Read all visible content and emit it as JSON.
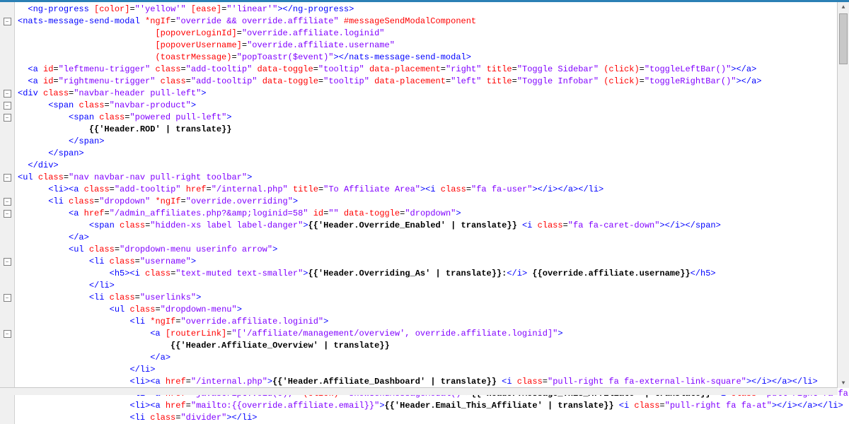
{
  "gutter": [
    "",
    "-",
    "",
    "",
    "",
    "",
    "",
    "-",
    "-",
    "-",
    "",
    "",
    "",
    "",
    "-",
    "",
    "-",
    "-",
    "",
    "",
    "",
    "-",
    "",
    "",
    "-",
    "",
    "",
    "-",
    "",
    "",
    "",
    "",
    ""
  ],
  "tokens": [
    [
      [
        2,
        "t-tag",
        "<ng-progress"
      ],
      [
        " "
      ],
      [
        "t-attr",
        "[color]"
      ],
      [
        "t-eq",
        "="
      ],
      [
        "t-val",
        "\"'yellow'\""
      ],
      [
        " "
      ],
      [
        "t-attr",
        "[ease]"
      ],
      [
        "t-eq",
        "="
      ],
      [
        "t-val",
        "\"'linear'\""
      ],
      [
        "t-tag",
        "></ng-progress>"
      ]
    ],
    [
      [
        0,
        "t-tag",
        "<nats-message-send-modal"
      ],
      [
        " "
      ],
      [
        "t-attr",
        "*ngIf"
      ],
      [
        "t-eq",
        "="
      ],
      [
        "t-val",
        "\"override && override.affiliate\""
      ],
      [
        " "
      ],
      [
        "t-attr",
        "#messageSendModalComponent"
      ]
    ],
    [
      [
        27,
        "t-attr",
        "[popoverLoginId]"
      ],
      [
        "t-eq",
        "="
      ],
      [
        "t-val",
        "\"override.affiliate.loginid\""
      ]
    ],
    [
      [
        27,
        "t-attr",
        "[popoverUsername]"
      ],
      [
        "t-eq",
        "="
      ],
      [
        "t-val",
        "\"override.affiliate.username\""
      ]
    ],
    [
      [
        27,
        "t-attr",
        "(toastrMessage)"
      ],
      [
        "t-eq",
        "="
      ],
      [
        "t-val",
        "\"popToastr($event)\""
      ],
      [
        "t-tag",
        "></nats-message-send-modal>"
      ]
    ],
    [
      [
        2,
        "t-tag",
        "<a"
      ],
      [
        " "
      ],
      [
        "t-attr",
        "id"
      ],
      [
        "t-eq",
        "="
      ],
      [
        "t-val",
        "\"leftmenu-trigger\""
      ],
      [
        " "
      ],
      [
        "t-attr",
        "class"
      ],
      [
        "t-eq",
        "="
      ],
      [
        "t-val",
        "\"add-tooltip\""
      ],
      [
        " "
      ],
      [
        "t-attr",
        "data-toggle"
      ],
      [
        "t-eq",
        "="
      ],
      [
        "t-val",
        "\"tooltip\""
      ],
      [
        " "
      ],
      [
        "t-attr",
        "data-placement"
      ],
      [
        "t-eq",
        "="
      ],
      [
        "t-val",
        "\"right\""
      ],
      [
        " "
      ],
      [
        "t-attr",
        "title"
      ],
      [
        "t-eq",
        "="
      ],
      [
        "t-val",
        "\"Toggle Sidebar\""
      ],
      [
        " "
      ],
      [
        "t-attr",
        "(click)"
      ],
      [
        "t-eq",
        "="
      ],
      [
        "t-val",
        "\"toggleLeftBar()\""
      ],
      [
        "t-tag",
        "></a>"
      ]
    ],
    [
      [
        2,
        "t-tag",
        "<a"
      ],
      [
        " "
      ],
      [
        "t-attr",
        "id"
      ],
      [
        "t-eq",
        "="
      ],
      [
        "t-val",
        "\"rightmenu-trigger\""
      ],
      [
        " "
      ],
      [
        "t-attr",
        "class"
      ],
      [
        "t-eq",
        "="
      ],
      [
        "t-val",
        "\"add-tooltip\""
      ],
      [
        " "
      ],
      [
        "t-attr",
        "data-toggle"
      ],
      [
        "t-eq",
        "="
      ],
      [
        "t-val",
        "\"tooltip\""
      ],
      [
        " "
      ],
      [
        "t-attr",
        "data-placement"
      ],
      [
        "t-eq",
        "="
      ],
      [
        "t-val",
        "\"left\""
      ],
      [
        " "
      ],
      [
        "t-attr",
        "title"
      ],
      [
        "t-eq",
        "="
      ],
      [
        "t-val",
        "\"Toggle Infobar\""
      ],
      [
        " "
      ],
      [
        "t-attr",
        "(click)"
      ],
      [
        "t-eq",
        "="
      ],
      [
        "t-val",
        "\"toggleRightBar()\""
      ],
      [
        "t-tag",
        "></a>"
      ]
    ],
    [
      [
        0,
        "t-tag",
        "<div"
      ],
      [
        " "
      ],
      [
        "t-attr",
        "class"
      ],
      [
        "t-eq",
        "="
      ],
      [
        "t-val",
        "\"navbar-header pull-left\""
      ],
      [
        "t-tag",
        ">"
      ]
    ],
    [
      [
        6,
        "t-tag",
        "<span"
      ],
      [
        " "
      ],
      [
        "t-attr",
        "class"
      ],
      [
        "t-eq",
        "="
      ],
      [
        "t-val",
        "\"navbar-product\""
      ],
      [
        "t-tag",
        ">"
      ]
    ],
    [
      [
        10,
        "t-tag",
        "<span"
      ],
      [
        " "
      ],
      [
        "t-attr",
        "class"
      ],
      [
        "t-eq",
        "="
      ],
      [
        "t-val",
        "\"powered pull-left\""
      ],
      [
        "t-tag",
        ">"
      ]
    ],
    [
      [
        14,
        "t-text",
        "{{'Header.ROD' | translate}}"
      ]
    ],
    [
      [
        10,
        "t-tag",
        "</span>"
      ]
    ],
    [
      [
        6,
        "t-tag",
        "</span>"
      ]
    ],
    [
      [
        2,
        "t-tag",
        "</div>"
      ]
    ],
    [
      [
        0,
        "t-tag",
        "<ul"
      ],
      [
        " "
      ],
      [
        "t-attr",
        "class"
      ],
      [
        "t-eq",
        "="
      ],
      [
        "t-val",
        "\"nav navbar-nav pull-right toolbar\""
      ],
      [
        "t-tag",
        ">"
      ]
    ],
    [
      [
        6,
        "t-tag",
        "<li><a"
      ],
      [
        " "
      ],
      [
        "t-attr",
        "class"
      ],
      [
        "t-eq",
        "="
      ],
      [
        "t-val",
        "\"add-tooltip\""
      ],
      [
        " "
      ],
      [
        "t-attr",
        "href"
      ],
      [
        "t-eq",
        "="
      ],
      [
        "t-val",
        "\"/internal.php\""
      ],
      [
        " "
      ],
      [
        "t-attr",
        "title"
      ],
      [
        "t-eq",
        "="
      ],
      [
        "t-val",
        "\"To Affiliate Area\""
      ],
      [
        "t-tag",
        "><i"
      ],
      [
        " "
      ],
      [
        "t-attr",
        "class"
      ],
      [
        "t-eq",
        "="
      ],
      [
        "t-val",
        "\"fa fa-user\""
      ],
      [
        "t-tag",
        "></i></a></li>"
      ]
    ],
    [
      [
        6,
        "t-tag",
        "<li"
      ],
      [
        " "
      ],
      [
        "t-attr",
        "class"
      ],
      [
        "t-eq",
        "="
      ],
      [
        "t-val",
        "\"dropdown\""
      ],
      [
        " "
      ],
      [
        "t-attr",
        "*ngIf"
      ],
      [
        "t-eq",
        "="
      ],
      [
        "t-val",
        "\"override.overriding\""
      ],
      [
        "t-tag",
        ">"
      ]
    ],
    [
      [
        10,
        "t-tag",
        "<a"
      ],
      [
        " "
      ],
      [
        "t-attr",
        "href"
      ],
      [
        "t-eq",
        "="
      ],
      [
        "t-val",
        "\"/admin_affiliates.php?&amp;loginid=58\""
      ],
      [
        " "
      ],
      [
        "t-attr",
        "id"
      ],
      [
        "t-eq",
        "="
      ],
      [
        "t-val",
        "\"\""
      ],
      [
        " "
      ],
      [
        "t-attr",
        "data-toggle"
      ],
      [
        "t-eq",
        "="
      ],
      [
        "t-val",
        "\"dropdown\""
      ],
      [
        "t-tag",
        ">"
      ]
    ],
    [
      [
        14,
        "t-tag",
        "<span"
      ],
      [
        " "
      ],
      [
        "t-attr",
        "class"
      ],
      [
        "t-eq",
        "="
      ],
      [
        "t-val",
        "\"hidden-xs label label-danger\""
      ],
      [
        "t-tag",
        ">"
      ],
      [
        "t-text",
        "{{'Header.Override_Enabled' | translate}} "
      ],
      [
        "t-tag",
        "<i"
      ],
      [
        " "
      ],
      [
        "t-attr",
        "class"
      ],
      [
        "t-eq",
        "="
      ],
      [
        "t-val",
        "\"fa fa-caret-down\""
      ],
      [
        "t-tag",
        "></i></span>"
      ]
    ],
    [
      [
        10,
        "t-tag",
        "</a>"
      ]
    ],
    [
      [
        10,
        "t-tag",
        "<ul"
      ],
      [
        " "
      ],
      [
        "t-attr",
        "class"
      ],
      [
        "t-eq",
        "="
      ],
      [
        "t-val",
        "\"dropdown-menu userinfo arrow\""
      ],
      [
        "t-tag",
        ">"
      ]
    ],
    [
      [
        14,
        "t-tag",
        "<li"
      ],
      [
        " "
      ],
      [
        "t-attr",
        "class"
      ],
      [
        "t-eq",
        "="
      ],
      [
        "t-val",
        "\"username\""
      ],
      [
        "t-tag",
        ">"
      ]
    ],
    [
      [
        18,
        "t-tag",
        "<h5><i"
      ],
      [
        " "
      ],
      [
        "t-attr",
        "class"
      ],
      [
        "t-eq",
        "="
      ],
      [
        "t-val",
        "\"text-muted text-smaller\""
      ],
      [
        "t-tag",
        ">"
      ],
      [
        "t-text",
        "{{'Header.Overriding_As' | translate}}:"
      ],
      [
        "t-tag",
        "</i>"
      ],
      [
        "t-text",
        " {{override.affiliate.username}}"
      ],
      [
        "t-tag",
        "</h5>"
      ]
    ],
    [
      [
        14,
        "t-tag",
        "</li>"
      ]
    ],
    [
      [
        14,
        "t-tag",
        "<li"
      ],
      [
        " "
      ],
      [
        "t-attr",
        "class"
      ],
      [
        "t-eq",
        "="
      ],
      [
        "t-val",
        "\"userlinks\""
      ],
      [
        "t-tag",
        ">"
      ]
    ],
    [
      [
        18,
        "t-tag",
        "<ul"
      ],
      [
        " "
      ],
      [
        "t-attr",
        "class"
      ],
      [
        "t-eq",
        "="
      ],
      [
        "t-val",
        "\"dropdown-menu\""
      ],
      [
        "t-tag",
        ">"
      ]
    ],
    [
      [
        22,
        "t-tag",
        "<li"
      ],
      [
        " "
      ],
      [
        "t-attr",
        "*ngIf"
      ],
      [
        "t-eq",
        "="
      ],
      [
        "t-val",
        "\"override.affiliate.loginid\""
      ],
      [
        "t-tag",
        ">"
      ]
    ],
    [
      [
        26,
        "t-tag",
        "<a"
      ],
      [
        " "
      ],
      [
        "t-attr",
        "[routerLink]"
      ],
      [
        "t-eq",
        "="
      ],
      [
        "t-val",
        "\"['/affiliate/management/overview', override.affiliate.loginid]\""
      ],
      [
        "t-tag",
        ">"
      ]
    ],
    [
      [
        30,
        "t-text",
        "{{'Header.Affiliate_Overview' | translate}}"
      ]
    ],
    [
      [
        26,
        "t-tag",
        "</a>"
      ]
    ],
    [
      [
        22,
        "t-tag",
        "</li>"
      ]
    ],
    [
      [
        22,
        "t-tag",
        "<li><a"
      ],
      [
        " "
      ],
      [
        "t-attr",
        "href"
      ],
      [
        "t-eq",
        "="
      ],
      [
        "t-val",
        "\"/internal.php\""
      ],
      [
        "t-tag",
        ">"
      ],
      [
        "t-text",
        "{{'Header.Affiliate_Dashboard' | translate}} "
      ],
      [
        "t-tag",
        "<i"
      ],
      [
        " "
      ],
      [
        "t-attr",
        "class"
      ],
      [
        "t-eq",
        "="
      ],
      [
        "t-val",
        "\"pull-right fa fa-external-link-square\""
      ],
      [
        "t-tag",
        "></i></a></li>"
      ]
    ],
    [
      [
        22,
        "t-tag",
        "<li><a"
      ],
      [
        " "
      ],
      [
        "t-attr",
        "href"
      ],
      [
        "t-eq",
        "="
      ],
      [
        "t-val",
        "\"javascript:void(0);\""
      ],
      [
        " "
      ],
      [
        "t-attr",
        "(click)"
      ],
      [
        "t-eq",
        "="
      ],
      [
        "t-val",
        "\"showSendMessageModal()\""
      ],
      [
        "t-tag",
        ">"
      ],
      [
        "t-text",
        "{{'Header.Message_This_Affiliate' | translate}} "
      ],
      [
        "t-tag",
        "<i"
      ],
      [
        " "
      ],
      [
        "t-attr",
        "class"
      ],
      [
        "t-eq",
        "="
      ],
      [
        "t-val",
        "\"pull-right fa fa-keyboa"
      ]
    ],
    [
      [
        22,
        "t-tag",
        "<li><a"
      ],
      [
        " "
      ],
      [
        "t-attr",
        "href"
      ],
      [
        "t-eq",
        "="
      ],
      [
        "t-val",
        "\"mailto:{{override.affiliate.email}}\""
      ],
      [
        "t-tag",
        ">"
      ],
      [
        "t-text",
        "{{'Header.Email_This_Affiliate' | translate}} "
      ],
      [
        "t-tag",
        "<i"
      ],
      [
        " "
      ],
      [
        "t-attr",
        "class"
      ],
      [
        "t-eq",
        "="
      ],
      [
        "t-val",
        "\"pull-right fa fa-at\""
      ],
      [
        "t-tag",
        "></i></a></li>"
      ]
    ],
    [
      [
        22,
        "t-tag",
        "<li"
      ],
      [
        " "
      ],
      [
        "t-attr",
        "class"
      ],
      [
        "t-eq",
        "="
      ],
      [
        "t-val",
        "\"divider\""
      ],
      [
        "t-tag",
        "></li>"
      ]
    ]
  ]
}
